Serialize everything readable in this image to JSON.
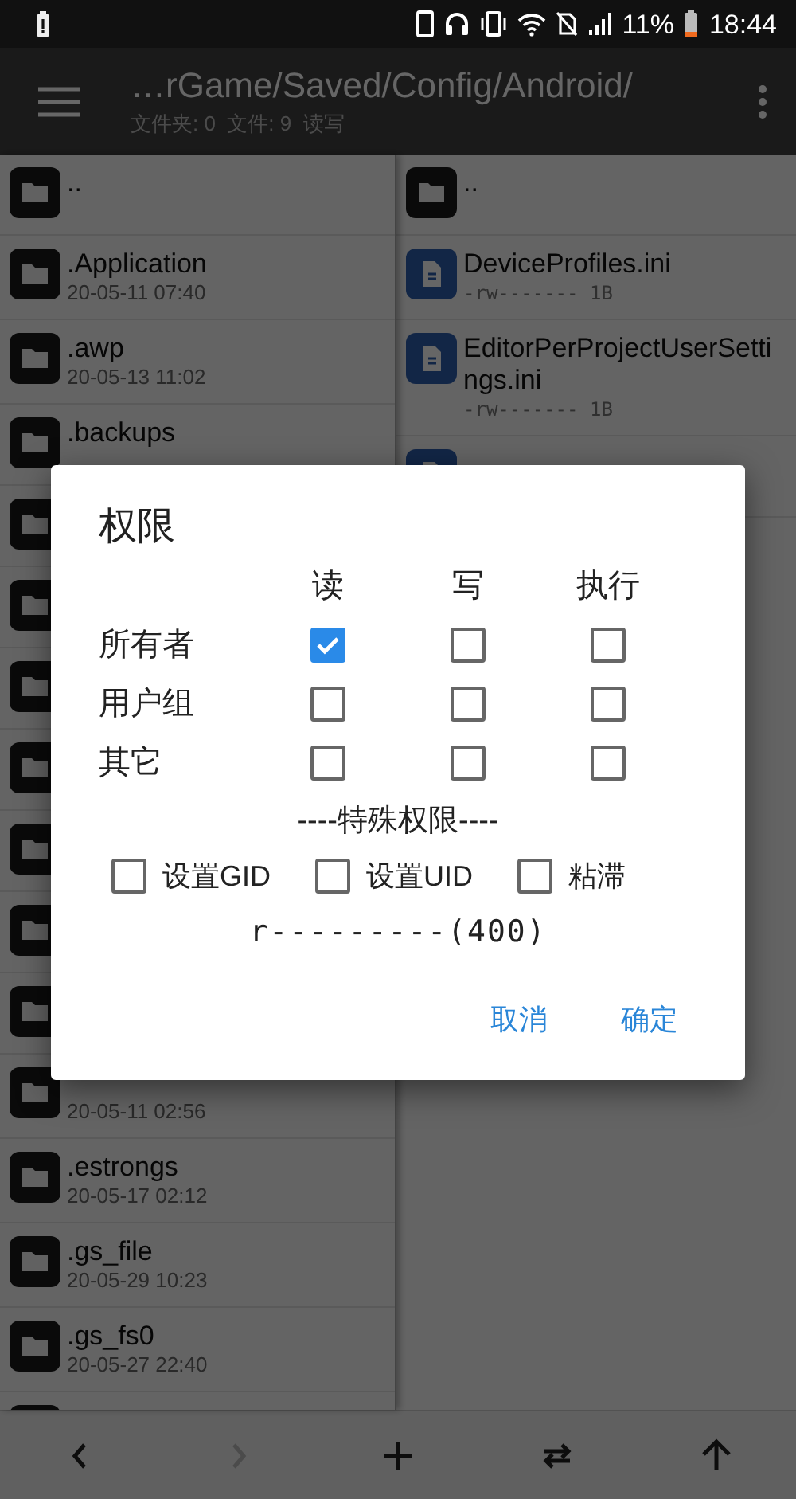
{
  "status_bar": {
    "battery_percent": "11%",
    "time": "18:44"
  },
  "toolbar": {
    "path": "…rGame/Saved/Config/Android/",
    "info": "文件夹: 0  文件: 9  读写"
  },
  "left_pane": {
    "items": [
      {
        "kind": "folder",
        "name": ".."
      },
      {
        "kind": "folder",
        "name": ".Application",
        "meta": "20-05-11 07:40"
      },
      {
        "kind": "folder",
        "name": ".awp",
        "meta": "20-05-13 11:02"
      },
      {
        "kind": "folder",
        "name": ".backups"
      },
      {
        "kind": "folder"
      },
      {
        "kind": "folder"
      },
      {
        "kind": "folder"
      },
      {
        "kind": "folder"
      },
      {
        "kind": "folder"
      },
      {
        "kind": "folder"
      },
      {
        "kind": "folder"
      },
      {
        "kind": "folder",
        "meta": "20-05-11 02:56"
      },
      {
        "kind": "folder",
        "name": ".estrongs",
        "meta": "20-05-17 02:12"
      },
      {
        "kind": "folder",
        "name": ".gs_file",
        "meta": "20-05-29 10:23"
      },
      {
        "kind": "folder",
        "name": ".gs_fs0",
        "meta": "20-05-27 22:40"
      },
      {
        "kind": "folder"
      }
    ]
  },
  "right_pane": {
    "items": [
      {
        "kind": "folder",
        "name": ".."
      },
      {
        "kind": "file",
        "name": "DeviceProfiles.ini",
        "meta": "-rw-------  1B"
      },
      {
        "kind": "file",
        "name": "EditorPerProjectUserSettings.ini",
        "meta": "-rw-------  1B"
      },
      {
        "kind": "file"
      }
    ]
  },
  "bottom_bar": {
    "buttons": [
      {
        "kind": "back",
        "disabled": false
      },
      {
        "kind": "forward",
        "disabled": true
      },
      {
        "kind": "add",
        "disabled": false
      },
      {
        "kind": "swap",
        "disabled": false
      },
      {
        "kind": "up",
        "disabled": false
      }
    ]
  },
  "dialog": {
    "title": "权限",
    "columns": [
      "读",
      "写",
      "执行"
    ],
    "rows": [
      {
        "label": "所有者",
        "checks": [
          true,
          false,
          false
        ]
      },
      {
        "label": "用户组",
        "checks": [
          false,
          false,
          false
        ]
      },
      {
        "label": "其它",
        "checks": [
          false,
          false,
          false
        ]
      }
    ],
    "special_heading": "----特殊权限----",
    "special": [
      {
        "label": "设置GID",
        "checked": false
      },
      {
        "label": "设置UID",
        "checked": false
      },
      {
        "label": "粘滞",
        "checked": false
      }
    ],
    "mode": "r---------(400)",
    "buttons": [
      "取消",
      "确定"
    ]
  }
}
